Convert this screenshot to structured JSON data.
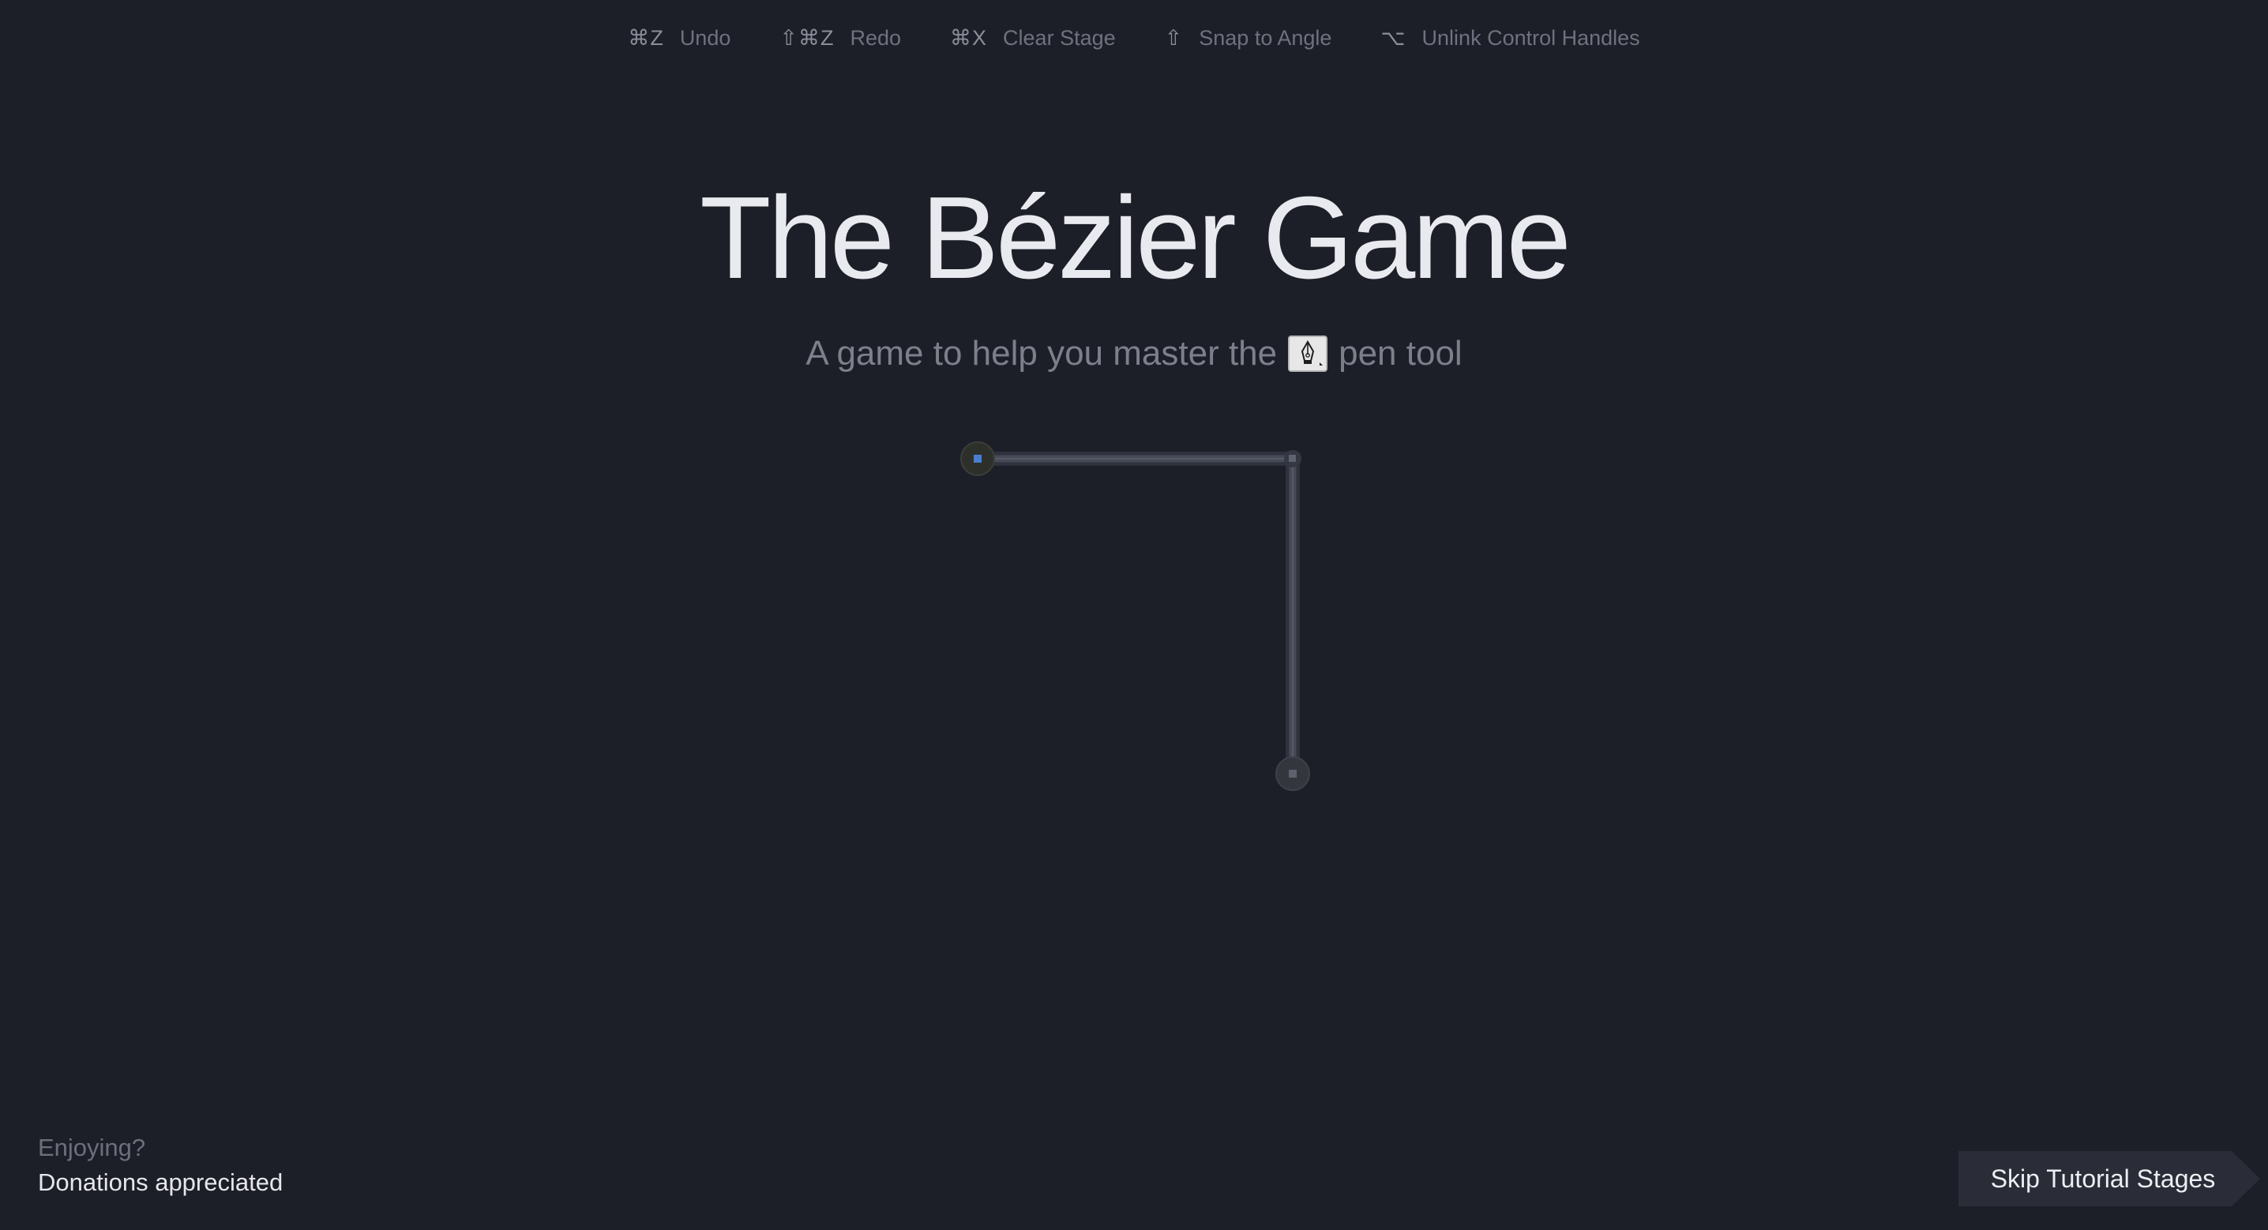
{
  "shortcuts": [
    {
      "keys": "⌘Z",
      "label": "Undo"
    },
    {
      "keys": "⇧⌘Z",
      "label": "Redo"
    },
    {
      "keys": "⌘X",
      "label": "Clear Stage"
    },
    {
      "keys": "⇧",
      "label": "Snap to Angle"
    },
    {
      "keys": "⌥",
      "label": "Unlink Control Handles"
    }
  ],
  "title": "The Bézier Game",
  "subtitle": {
    "before": "A game to help you master the",
    "icon": "pen-tool-icon",
    "after": "pen tool"
  },
  "stage": {
    "shape": "corner-path",
    "anchors": [
      "start-anchor",
      "corner-anchor",
      "end-anchor"
    ]
  },
  "footer": {
    "enjoy": "Enjoying?",
    "donate": "Donations appreciated"
  },
  "skip": {
    "label": "Skip Tutorial Stages"
  },
  "colors": {
    "background": "#1d1f28",
    "path": "#3b3f4a",
    "start_point": "#4a7dd1"
  }
}
